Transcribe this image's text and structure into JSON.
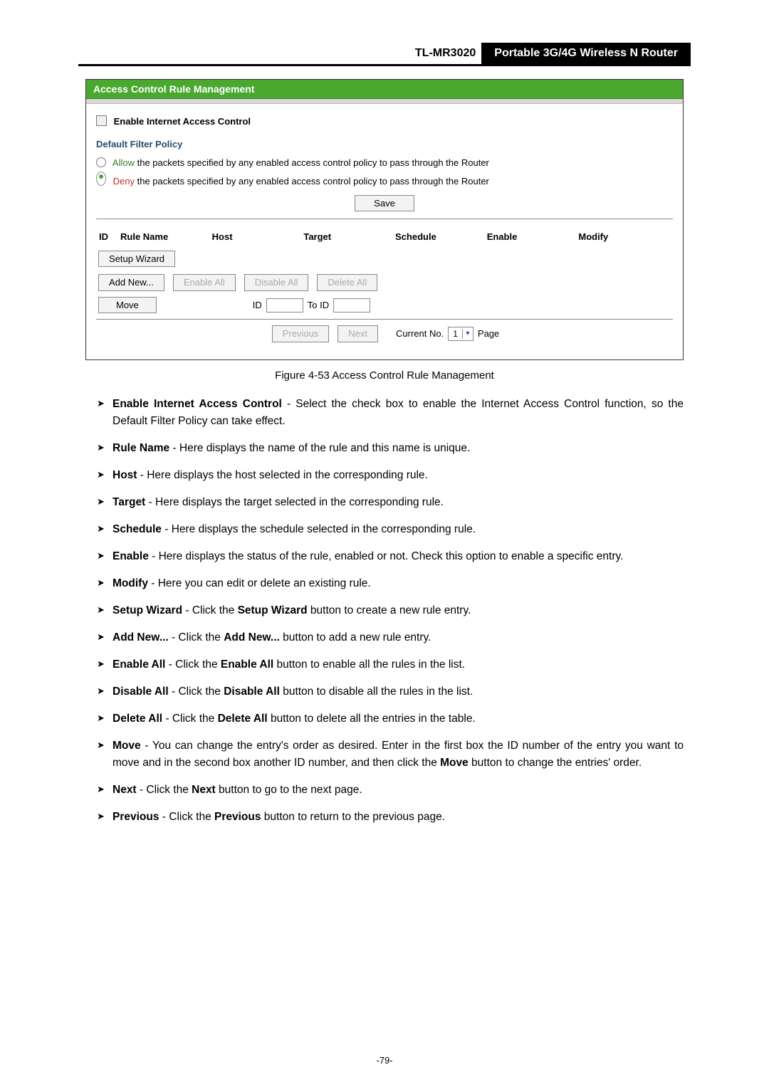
{
  "header": {
    "model": "TL-MR3020",
    "product": "Portable 3G/4G Wireless N Router"
  },
  "figure": {
    "title": "Access Control Rule Management",
    "enable_iac_label": "Enable Internet Access Control",
    "policy_heading": "Default Filter Policy",
    "policy_allow_pre": "Allow",
    "policy_allow_rest": " the packets specified by any enabled access control policy to pass through the Router",
    "policy_deny_pre": "Deny",
    "policy_deny_rest": " the packets specified by any enabled access control policy to pass through the Router",
    "btn_save": "Save",
    "table_headers": {
      "id": "ID",
      "rule": "Rule Name",
      "host": "Host",
      "target": "Target",
      "schedule": "Schedule",
      "enable": "Enable",
      "modify": "Modify"
    },
    "btn_setup_wizard": "Setup Wizard",
    "btn_add_new": "Add New...",
    "btn_enable_all": "Enable All",
    "btn_disable_all": "Disable All",
    "btn_delete_all": "Delete All",
    "btn_move": "Move",
    "label_id": "ID",
    "label_to_id": "To ID",
    "btn_previous": "Previous",
    "btn_next": "Next",
    "label_current_no": "Current No.",
    "sel_page_value": "1",
    "label_page": "Page"
  },
  "caption": "Figure 4-53    Access Control Rule Management",
  "bullets": [
    {
      "term": "Enable Internet Access Control",
      "desc": " - Select the check box to enable the Internet Access Control function, so the Default Filter Policy can take effect."
    },
    {
      "term": "Rule Name",
      "desc": " - Here displays the name of the rule and this name is unique."
    },
    {
      "term": "Host",
      "desc": " - Here displays the host selected in the corresponding rule."
    },
    {
      "term": "Target",
      "desc": " - Here displays the target selected in the corresponding rule."
    },
    {
      "term": "Schedule",
      "desc": " - Here displays the schedule selected in the corresponding rule."
    },
    {
      "term": "Enable",
      "desc": " - Here displays the status of the rule, enabled or not. Check this option to enable a specific entry."
    },
    {
      "term": "Modify",
      "desc": " - Here you can edit or delete an existing rule."
    },
    {
      "term": "Setup Wizard",
      "desc_pre": " - Click the ",
      "inner_bold": "Setup Wizard",
      "desc_post": " button to create a new rule entry."
    },
    {
      "term": "Add New...  ",
      "desc_pre": " - Click the ",
      "inner_bold": "Add New...",
      "desc_post": " button to add a new rule entry."
    },
    {
      "term": "Enable All",
      "desc_pre": " - Click the ",
      "inner_bold": "Enable All",
      "desc_post": " button to enable all the rules in the list."
    },
    {
      "term": "Disable All",
      "desc_pre": " - Click the ",
      "inner_bold": "Disable All",
      "desc_post": " button to disable all the rules in the list."
    },
    {
      "term": "Delete All",
      "desc_pre": " - Click the ",
      "inner_bold": "Delete All",
      "desc_post": " button to delete all the entries in the table."
    },
    {
      "term": "Move",
      "desc_pre": " - You can change the entry's order as desired. Enter in the first box the ID number of the entry you want to move and in the second box another ID number, and then click the ",
      "inner_bold": "Move",
      "desc_post": " button to change the entries' order."
    },
    {
      "term": "Next",
      "desc_pre": " - Click the ",
      "inner_bold": "Next",
      "desc_post": " button to go to the next page."
    },
    {
      "term": "Previous",
      "desc_pre": " - Click the ",
      "inner_bold": "Previous",
      "desc_post": " button to return to the previous page."
    }
  ],
  "page_number": "-79-"
}
